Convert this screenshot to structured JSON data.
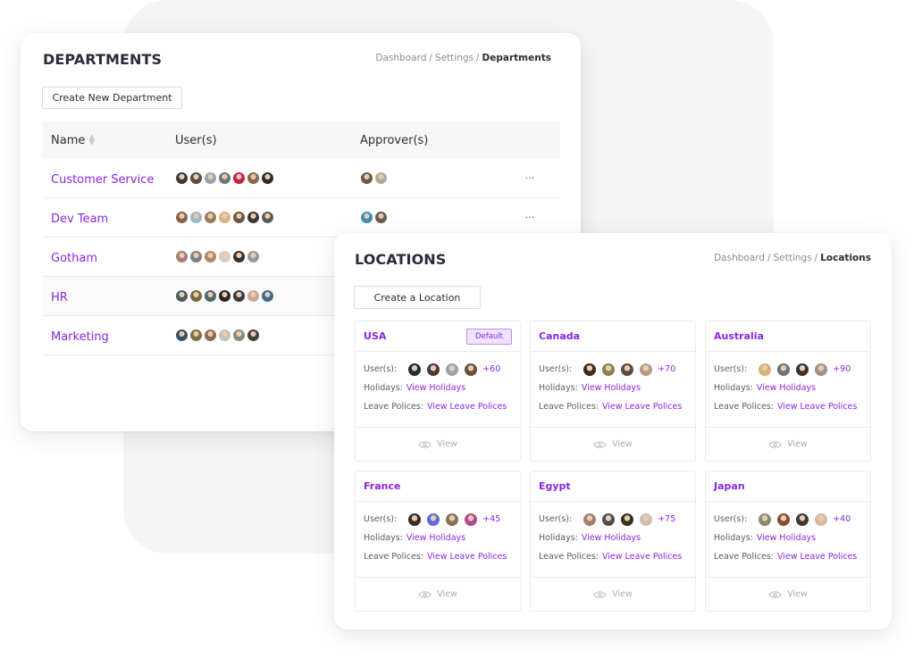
{
  "departments": {
    "title": "DEPARTMENTS",
    "breadcrumb": {
      "items": [
        "Dashboard",
        "Settings"
      ],
      "current": "Departments",
      "separator": "/"
    },
    "create_button": "Create New Department",
    "columns": {
      "name": "Name",
      "users": "User(s)",
      "approvers": "Approver(s)"
    },
    "rows": [
      {
        "name": "Customer Service",
        "users": [
          "#3a3a3a",
          "#5a4a3f",
          "#9aa3a8",
          "#6d7478",
          "#c4204a",
          "#8a6a4a",
          "#2d2d2d"
        ],
        "approvers": [
          "#6a5a4a",
          "#b0a898"
        ],
        "action": "···"
      },
      {
        "name": "Dev Team",
        "users": [
          "#8a6248",
          "#9cb7c4",
          "#9a7a5a",
          "#d8b47a",
          "#6a5444",
          "#3d3535",
          "#5a5a58"
        ],
        "approvers": [
          "#3f8fb0",
          "#6a5a4a"
        ],
        "action": "···"
      },
      {
        "name": "Gotham",
        "users": [
          "#a08070",
          "#7a8288",
          "#b08866",
          "#d8ccc0",
          "#3a2f2f",
          "#9a9a9a"
        ],
        "approvers": [],
        "action": ""
      },
      {
        "name": "HR",
        "users": [
          "#4a5860",
          "#7a6a3a",
          "#4a6870",
          "#2a2420",
          "#3a3a3a",
          "#c8a898",
          "#3f6a8a"
        ],
        "approvers": [],
        "action": ""
      },
      {
        "name": "Marketing",
        "users": [
          "#3a5060",
          "#7a7040",
          "#8a6a54",
          "#c8c0b8",
          "#8a8a7a",
          "#4a4038"
        ],
        "approvers": [],
        "action": ""
      }
    ]
  },
  "locations": {
    "title": "LOCATIONS",
    "breadcrumb": {
      "items": [
        "Dashboard",
        "Settings"
      ],
      "current": "Locations",
      "separator": "/"
    },
    "create_button": "Create a Location",
    "labels": {
      "users": "User(s):",
      "holidays": "Holidays:",
      "holidays_link": "View Holidays",
      "policies": "Leave Polices:",
      "policies_link": "View Leave Polices",
      "view": "View"
    },
    "cards": [
      {
        "name": "USA",
        "badge": "Default",
        "avatars": [
          "#2a2a2a",
          "#4a3a32",
          "#9aa4a8",
          "#6a5040"
        ],
        "more": "+60"
      },
      {
        "name": "Canada",
        "badge": "",
        "avatars": [
          "#3a2a22",
          "#8a8050",
          "#5a4a44",
          "#b89a88"
        ],
        "more": "+70"
      },
      {
        "name": "Australia",
        "badge": "",
        "avatars": [
          "#d8b070",
          "#6a7078",
          "#3a3030",
          "#a09088"
        ],
        "more": "+90"
      },
      {
        "name": "France",
        "badge": "",
        "avatars": [
          "#3a2a20",
          "#5a6ad8",
          "#8a7060",
          "#b04a8a"
        ],
        "more": "+45"
      },
      {
        "name": "Egypt",
        "badge": "",
        "avatars": [
          "#a08070",
          "#4a5050",
          "#3a3020",
          "#c8c0b8"
        ],
        "more": "+75"
      },
      {
        "name": "Japan",
        "badge": "",
        "avatars": [
          "#8a8a78",
          "#8a4a3a",
          "#3a3a30",
          "#d8b8a0"
        ],
        "more": "+40"
      }
    ]
  },
  "colors": {
    "accent": "#8a25e6",
    "badge_bg": "#efe3fd",
    "background_blob": "#f5f5f5"
  }
}
